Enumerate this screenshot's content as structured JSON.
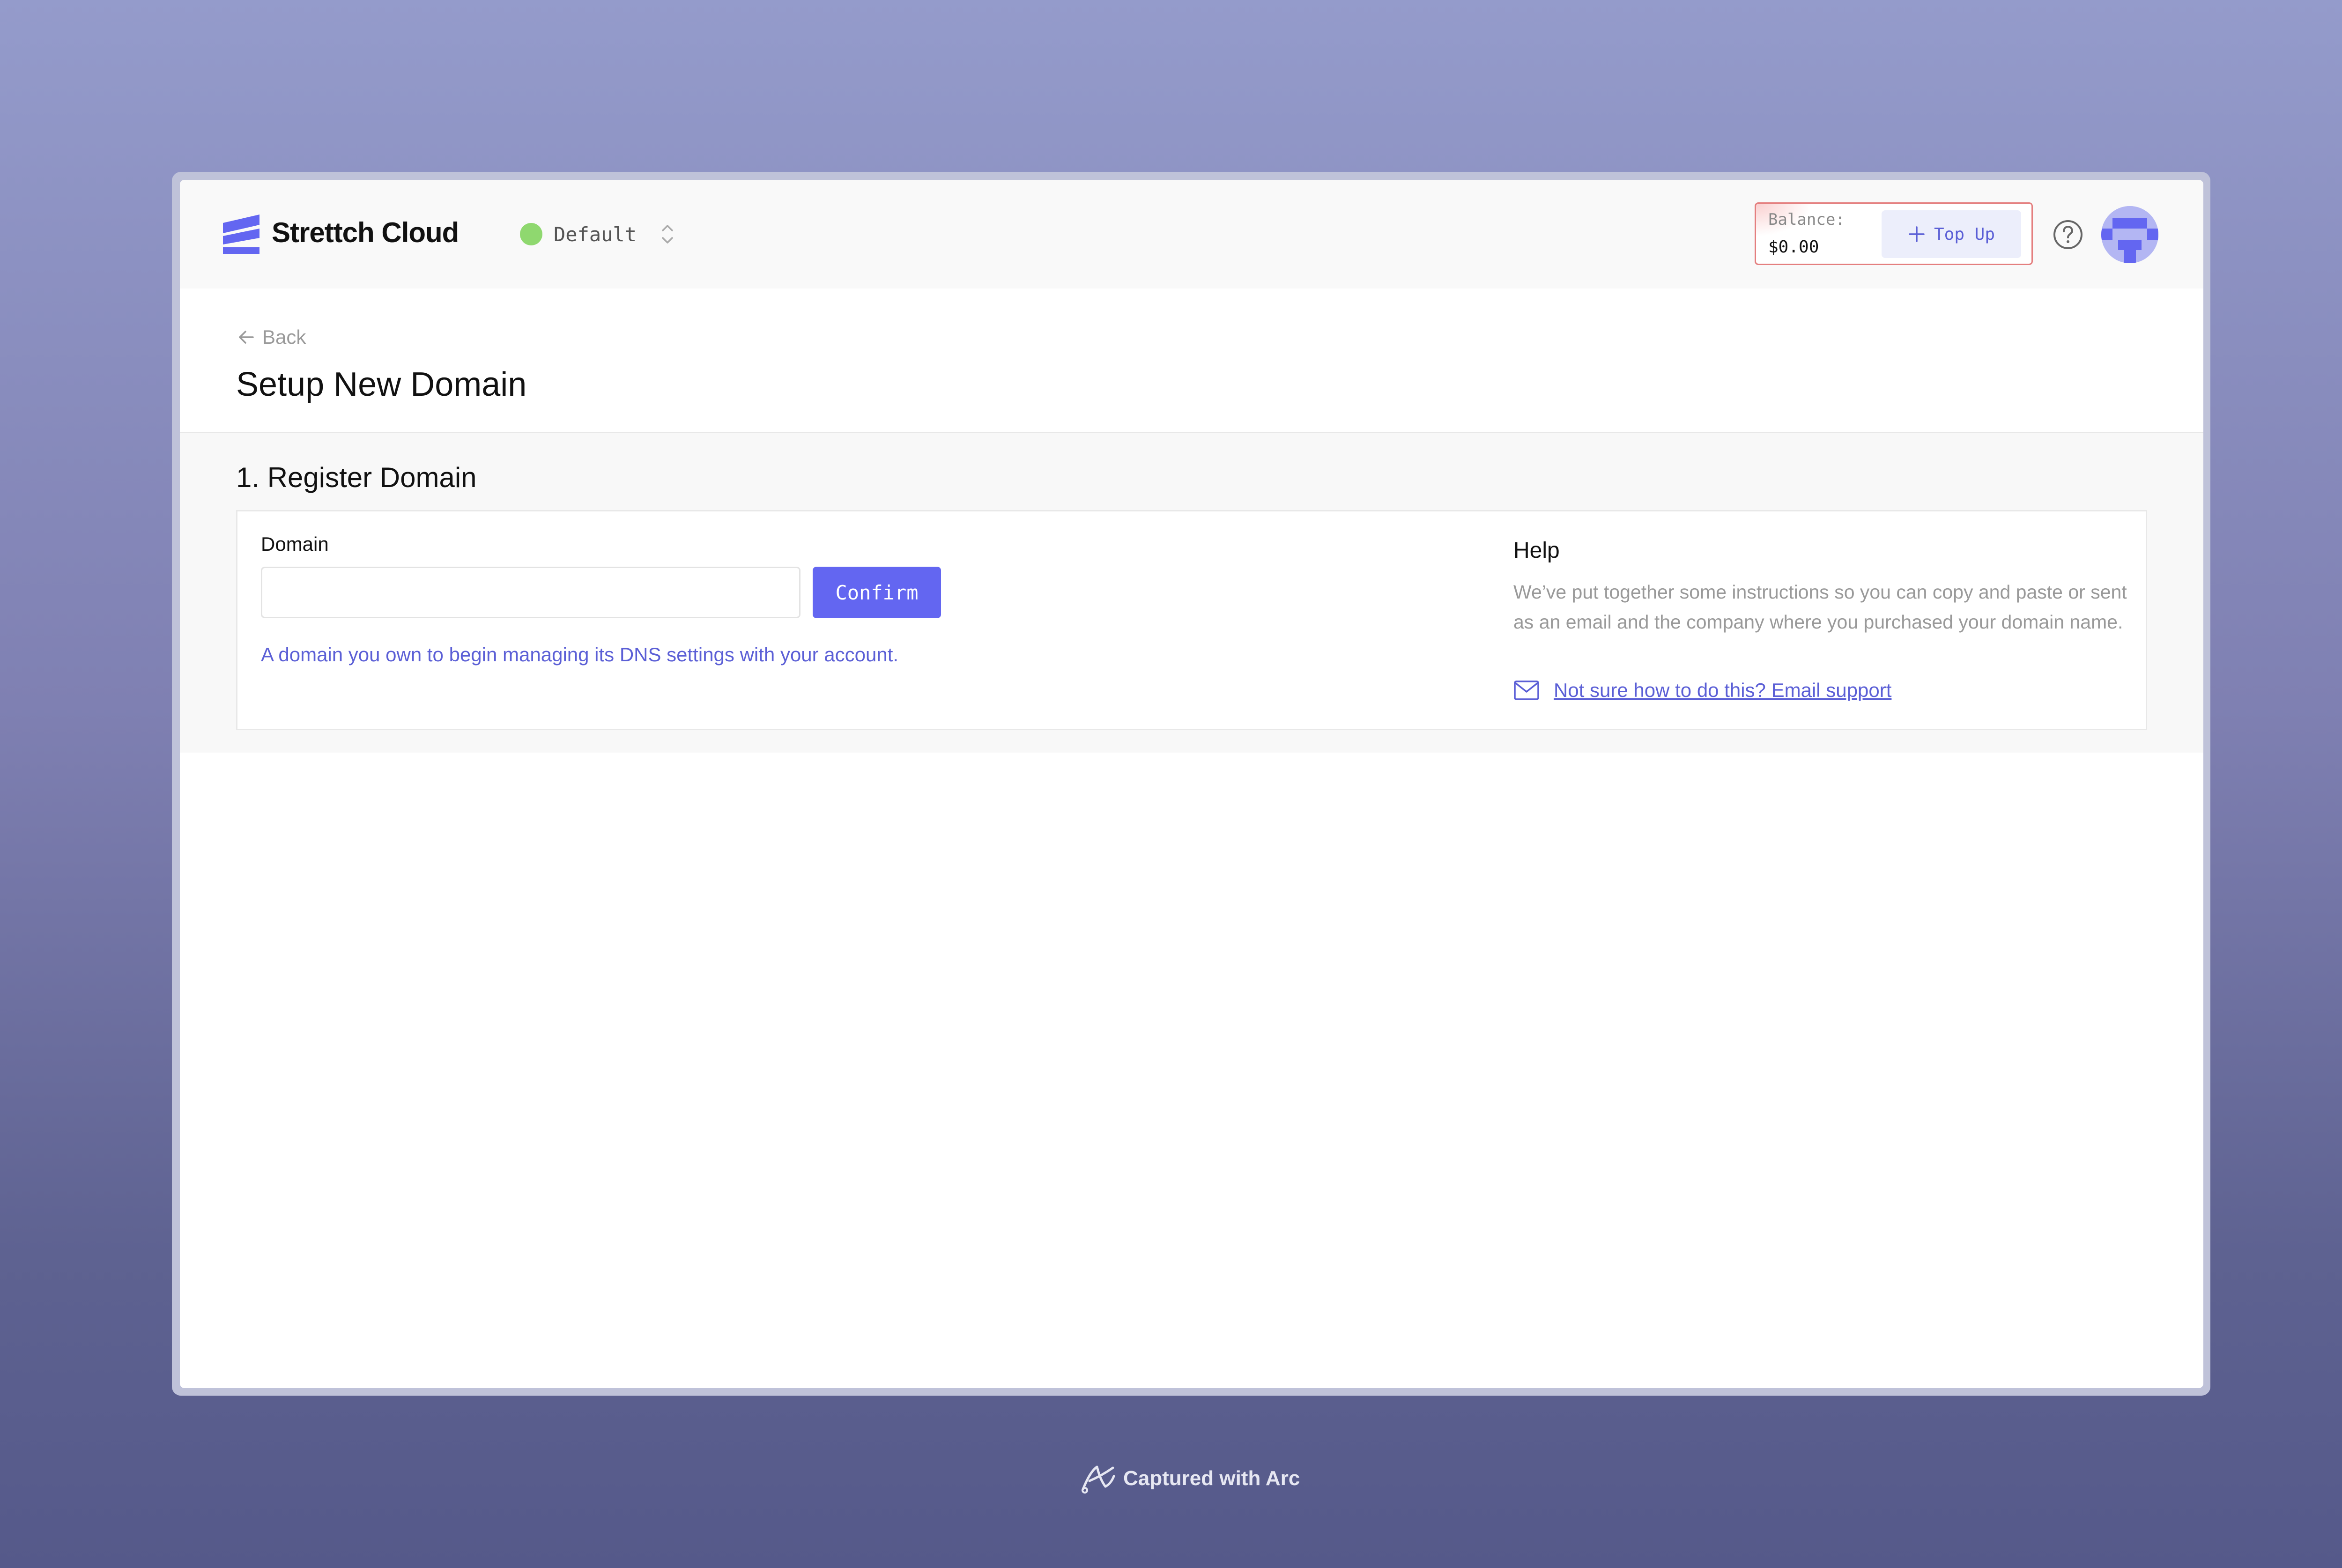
{
  "app": {
    "name": "Strettch Cloud",
    "environment": "Default",
    "environment_status_color": "#8fd86f",
    "accent_color": "#6366f1"
  },
  "header": {
    "balance_label": "Balance:",
    "balance_value": "$0.00",
    "topup_label": "Top Up",
    "icons": [
      "logo-icon",
      "plus-icon",
      "help-icon",
      "avatar"
    ]
  },
  "page": {
    "back_label": "Back",
    "title": "Setup New Domain"
  },
  "section": {
    "title": "1. Register Domain",
    "field_label": "Domain",
    "field_value": "",
    "confirm_label": "Confirm",
    "hint": "A domain you own to begin managing its DNS settings with your account."
  },
  "help": {
    "title": "Help",
    "text": "We’ve put together some instructions so you can copy and paste or sent as an email and the company where you purchased your domain name.",
    "link": "Not sure how to do this? Email support"
  },
  "footer": {
    "capture_text": "Captured with Arc"
  }
}
